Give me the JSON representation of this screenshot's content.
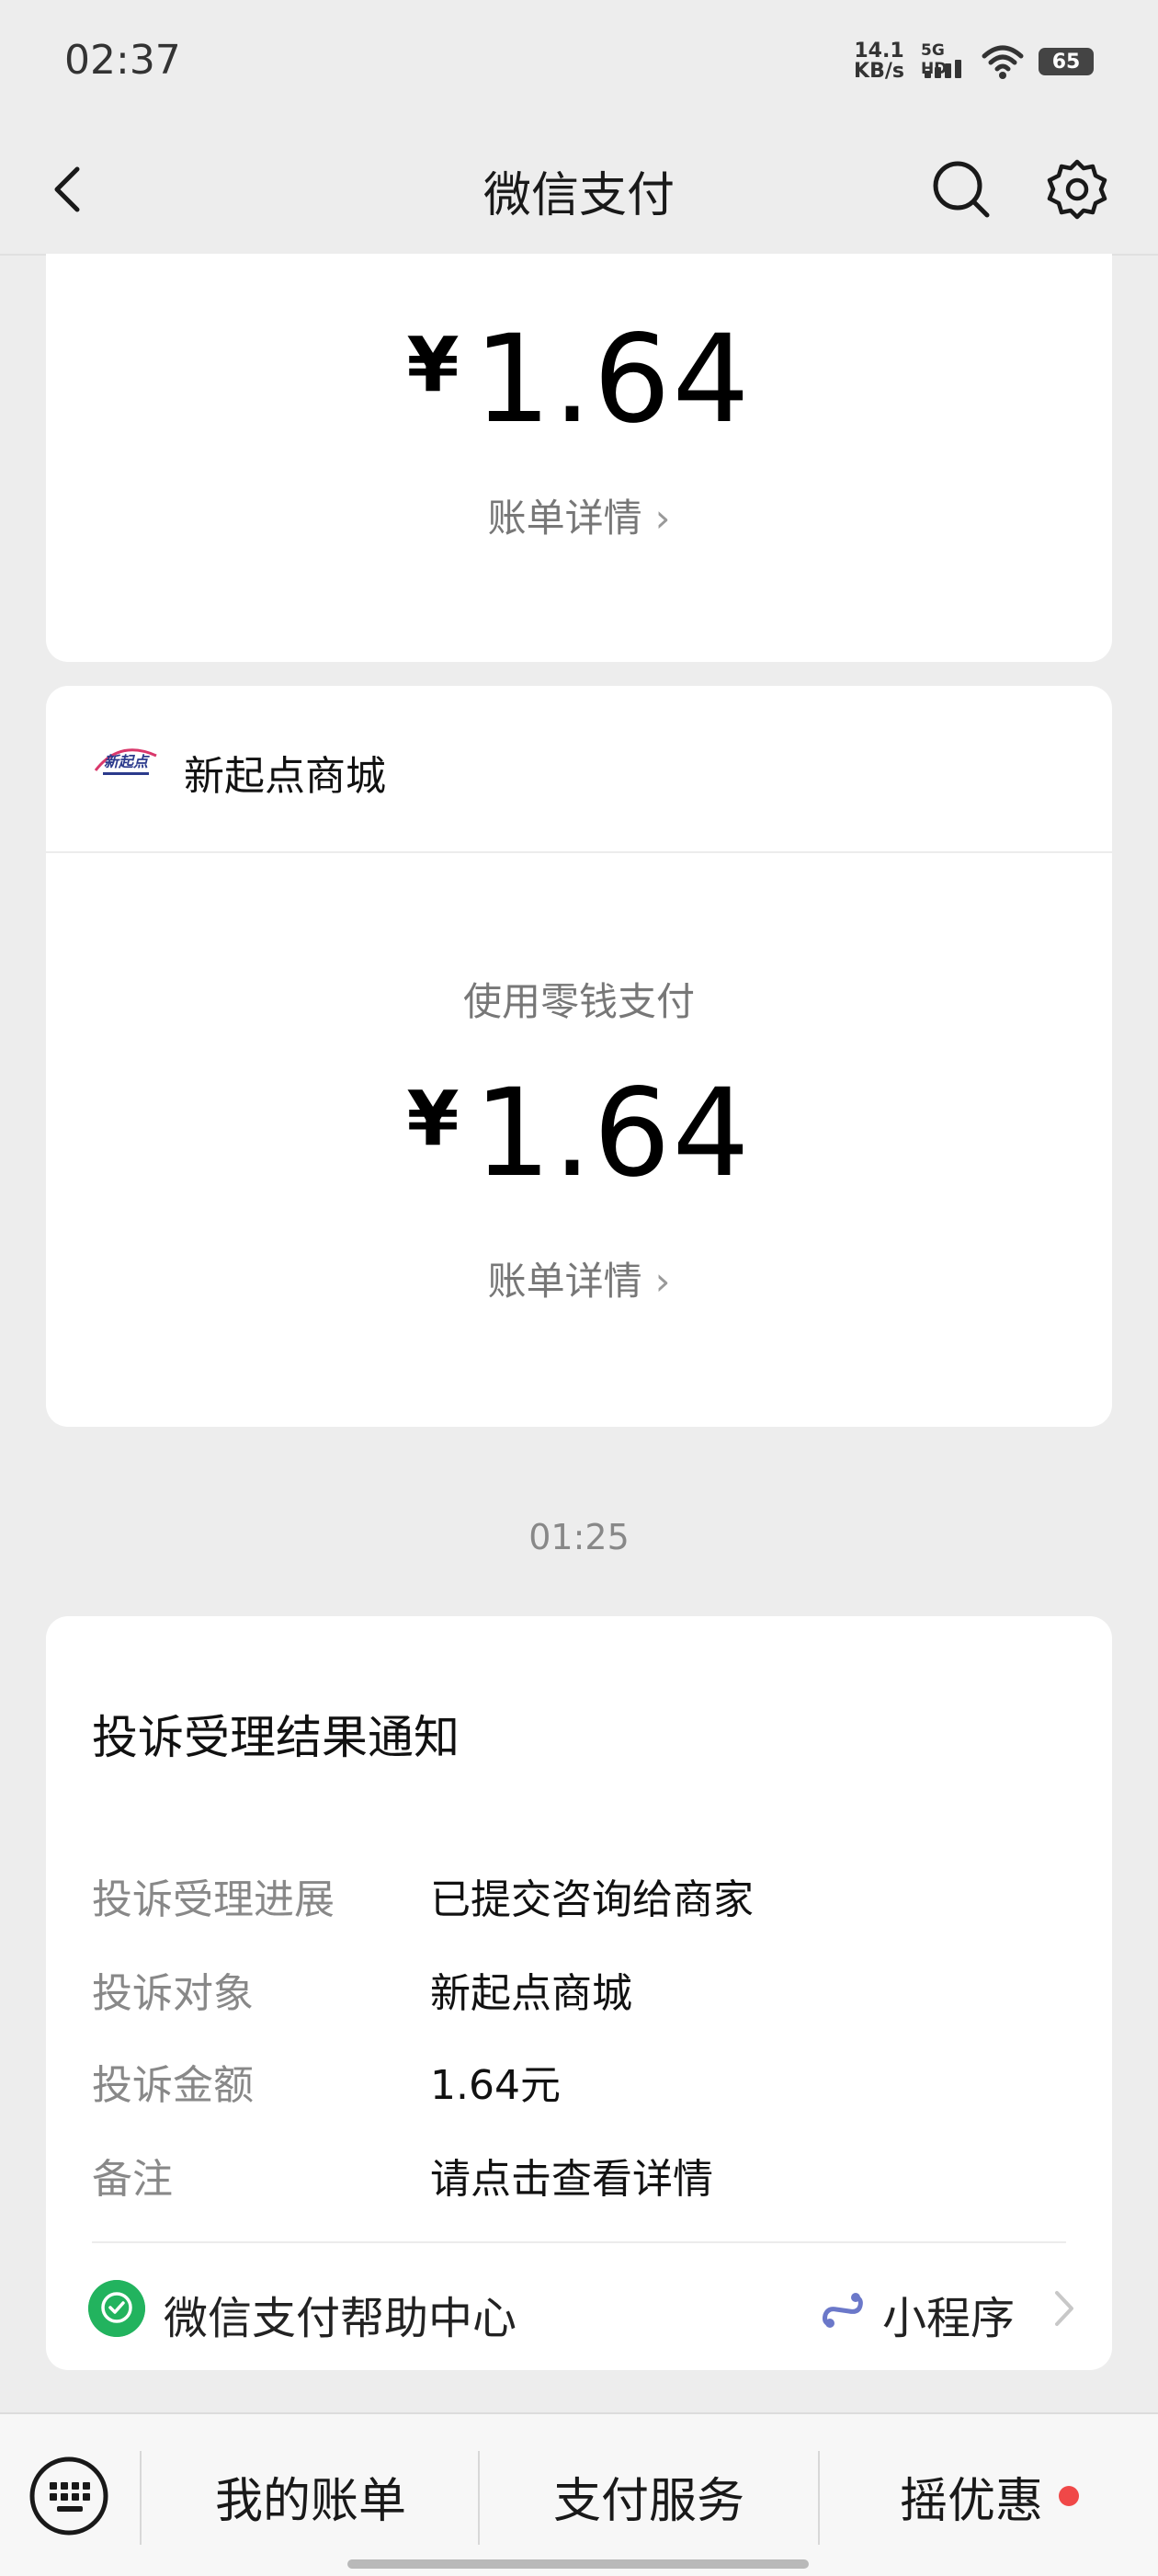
{
  "status": {
    "time": "02:37",
    "net_speed_value": "14.1",
    "net_speed_unit": "KB/s",
    "signal_label": "5G HD",
    "battery": "65"
  },
  "nav": {
    "title": "微信支付",
    "back_icon": "chevron-left-icon",
    "search_icon": "search-icon",
    "settings_icon": "gear-icon"
  },
  "payment_top": {
    "currency": "¥",
    "amount": "1.64",
    "bill_link": "账单详情"
  },
  "payment_card": {
    "merchant": "新起点商城",
    "logo_text": "新起点",
    "pay_method": "使用零钱支付",
    "currency": "¥",
    "amount": "1.64",
    "bill_link": "账单详情"
  },
  "timestamp": "01:25",
  "complaint": {
    "title": "投诉受理结果通知",
    "rows": [
      {
        "key": "投诉受理进展",
        "value": "已提交咨询给商家"
      },
      {
        "key": "投诉对象",
        "value": "新起点商城"
      },
      {
        "key": "投诉金额",
        "value": "1.64元"
      },
      {
        "key": "备注",
        "value": "请点击查看详情"
      }
    ],
    "help_center": "微信支付帮助中心",
    "mini_program": "小程序"
  },
  "bottom_bar": {
    "keyboard_icon": "keyboard-icon",
    "items": [
      "我的账单",
      "支付服务",
      "摇优惠"
    ]
  },
  "colors": {
    "background": "#ededed",
    "card": "#ffffff",
    "brand_green": "#22b35e",
    "badge_red": "#f04848"
  }
}
